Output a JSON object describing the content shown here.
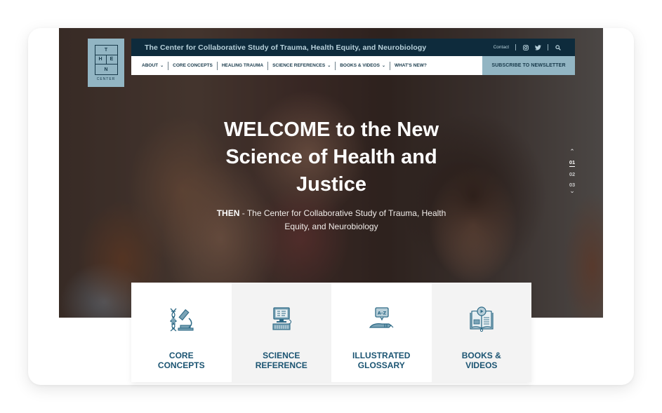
{
  "logo": {
    "letters": [
      "T",
      "H",
      "E",
      "N"
    ],
    "subtitle": "CENTER"
  },
  "topbar": {
    "title": "The Center for Collaborative Study of Trauma, Health Equity, and Neurobiology",
    "contact_label": "Contact",
    "icons": [
      "instagram-icon",
      "twitter-icon",
      "search-icon"
    ]
  },
  "nav": {
    "items": [
      {
        "label": "ABOUT",
        "has_dropdown": true
      },
      {
        "label": "CORE CONCEPTS",
        "has_dropdown": false
      },
      {
        "label": "HEALING TRAUMA",
        "has_dropdown": false
      },
      {
        "label": "SCIENCE REFERENCES",
        "has_dropdown": true
      },
      {
        "label": "BOOKS & VIDEOS",
        "has_dropdown": true
      },
      {
        "label": "WHAT'S NEW?",
        "has_dropdown": false
      }
    ],
    "subscribe_label": "SUBSCRIBE TO NEWSLETTER"
  },
  "hero": {
    "title_line1": "WELCOME to the New",
    "title_line2": "Science of Health and",
    "title_line3": "Justice",
    "subtitle_bold": "THEN",
    "subtitle_rest": " - The Center for Collaborative Study of Trauma, Health Equity, and Neurobiology"
  },
  "slider": {
    "slides": [
      "01",
      "02",
      "03"
    ],
    "active": "01"
  },
  "cards": [
    {
      "line1": "CORE",
      "line2": "CONCEPTS",
      "icon": "dna-microscope-icon"
    },
    {
      "line1": "SCIENCE",
      "line2": "REFERENCE",
      "icon": "computer-keyboard-icon"
    },
    {
      "line1": "ILLUSTRATED",
      "line2": "GLOSSARY",
      "icon": "a-z-glossary-pen-icon"
    },
    {
      "line1": "BOOKS &",
      "line2": "VIDEOS",
      "icon": "book-video-icon"
    }
  ],
  "colors": {
    "navy": "#0e2b3c",
    "accent_light_blue": "#92b5c3",
    "card_text": "#1b5472",
    "icon_teal": "#2e6a86"
  }
}
